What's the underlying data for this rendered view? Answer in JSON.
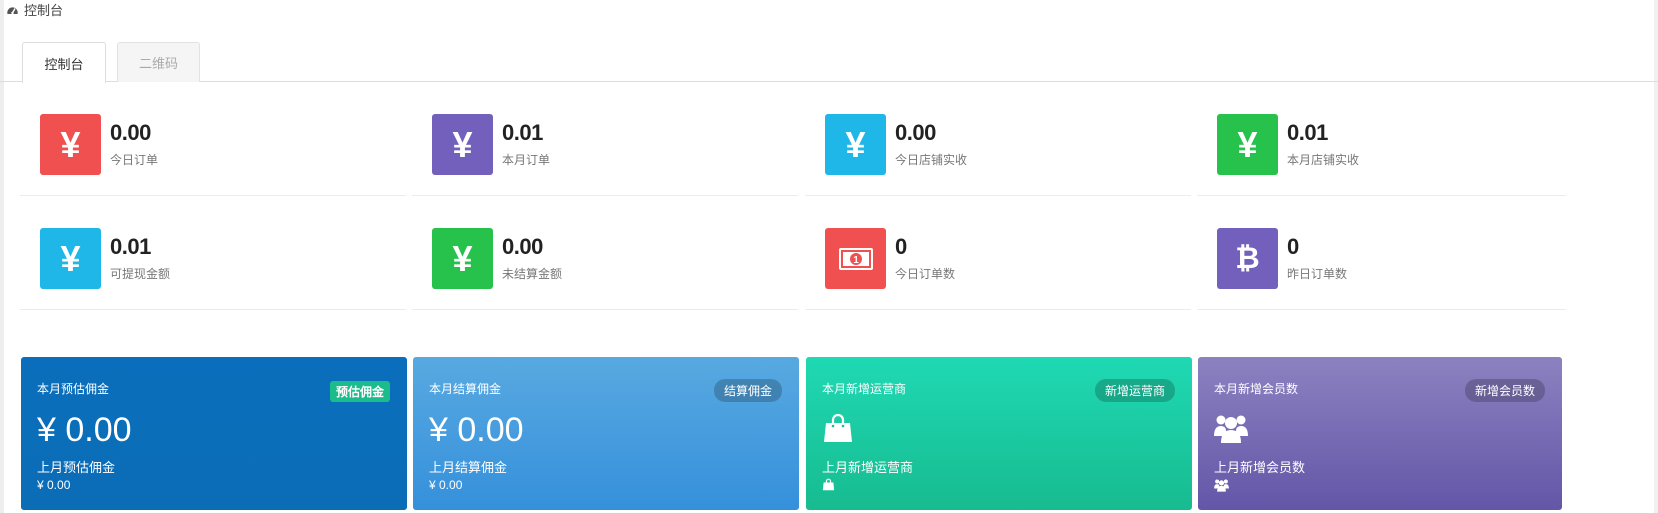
{
  "breadcrumb": {
    "label": "控制台",
    "icon": "dashboard-icon"
  },
  "tabs": [
    {
      "label": "控制台",
      "active": true
    },
    {
      "label": "二维码",
      "active": false
    }
  ],
  "stats": [
    {
      "value": "0.00",
      "label": "今日订单",
      "icon": "yen-icon",
      "color": "#f0504f"
    },
    {
      "value": "0.01",
      "label": "本月订单",
      "icon": "yen-icon",
      "color": "#7260bc"
    },
    {
      "value": "0.00",
      "label": "今日店铺实收",
      "icon": "yen-icon",
      "color": "#1fb6e8"
    },
    {
      "value": "0.01",
      "label": "本月店铺实收",
      "icon": "yen-icon",
      "color": "#27c24c"
    },
    {
      "value": "0.01",
      "label": "可提现金额",
      "icon": "yen-icon",
      "color": "#1fb6e8"
    },
    {
      "value": "0.00",
      "label": "未结算金额",
      "icon": "yen-icon",
      "color": "#27c24c"
    },
    {
      "value": "0",
      "label": "今日订单数",
      "icon": "money-bill-icon",
      "color": "#f0504f"
    },
    {
      "value": "0",
      "label": "昨日订单数",
      "icon": "bitcoin-icon",
      "color": "#7260bc"
    }
  ],
  "cards": [
    {
      "title": "本月预估佣金",
      "badge": "预估佣金",
      "big_value": "¥ 0.00",
      "sub_label": "上月预估佣金",
      "sub_value": "¥ 0.00",
      "color_top": "#0a6ebc",
      "color_bottom": "#0b6db6"
    },
    {
      "title": "本月结算佣金",
      "badge": "结算佣金",
      "big_value": "¥ 0.00",
      "sub_label": "上月结算佣金",
      "sub_value": "¥ 0.00",
      "color_top": "#58a9e0",
      "color_bottom": "#3590db"
    },
    {
      "title": "本月新增运营商",
      "badge": "新增运营商",
      "big_icon": "shopping-bag-icon",
      "sub_label": "上月新增运营商",
      "sub_icon": "shopping-bag-icon",
      "color_top": "#1fd9b4",
      "color_bottom": "#17bb8f"
    },
    {
      "title": "本月新增会员数",
      "badge": "新增会员数",
      "big_icon": "users-icon",
      "sub_label": "上月新增会员数",
      "sub_icon": "users-icon",
      "color_top": "#8c82c0",
      "color_bottom": "#6356a8"
    }
  ]
}
